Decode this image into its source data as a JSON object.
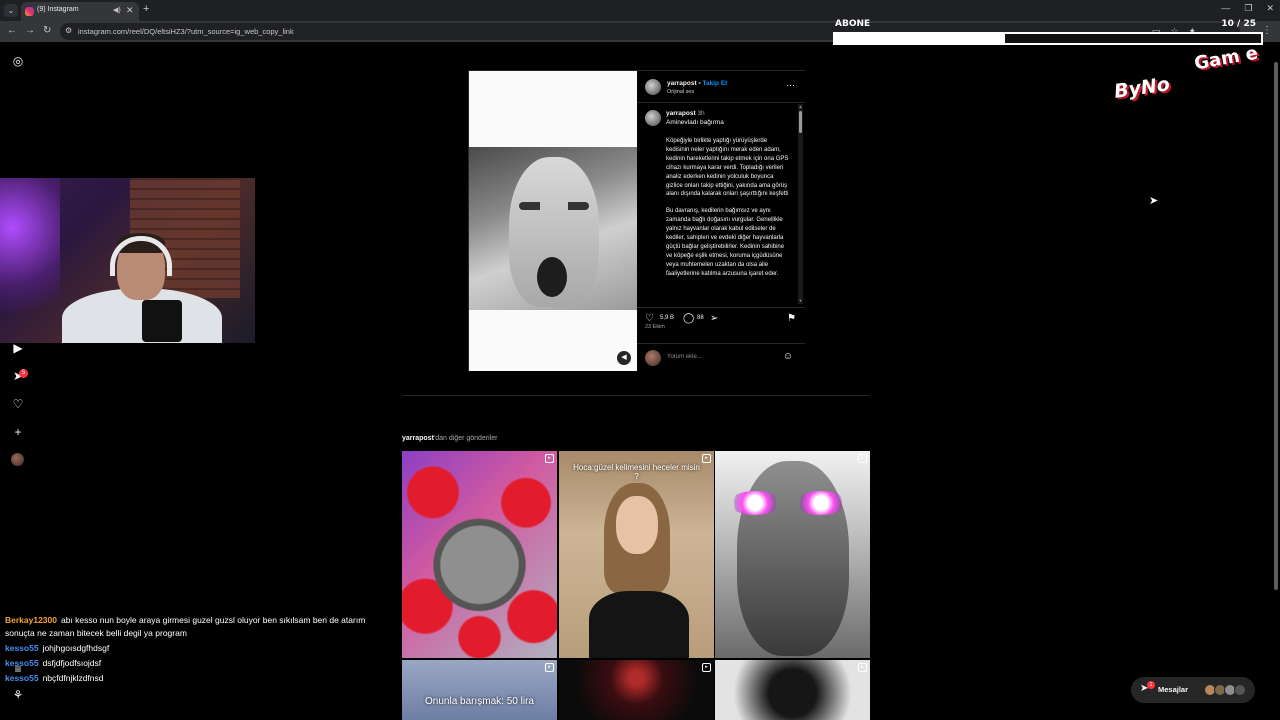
{
  "browser": {
    "tab_title": "(9) Instagram",
    "url": "instagram.com/reel/DQ/eltsiHZ3/?utm_source=ig_web_copy_link",
    "icons": [
      "tab-search-icon",
      "audio-icon",
      "close-icon",
      "new-tab-icon",
      "back-icon",
      "forward-icon",
      "reload-icon",
      "site-info-icon",
      "cast-icon",
      "star-icon",
      "extensions-icon",
      "menu-icon"
    ]
  },
  "stream_overlay": {
    "goal_label": "ABONE",
    "goal_count": "10 / 25",
    "goal_progress": 0.4,
    "logo_main": "ByNo",
    "logo_sub": "Gam e",
    "chat": [
      {
        "user": "Berkay12300",
        "color": "#f2a33a",
        "text": "abı kesso nun boyle araya girmesi guzel guzsl oluyor ben sıkılsam ben de atarım sonuçta ne zaman bitecek belli degil ya program"
      },
      {
        "user": "kesso55",
        "color": "#4a8ef0",
        "text": "johjhgoısdgfhdsgf"
      },
      {
        "user": "kesso55",
        "color": "#4a8ef0",
        "text": "dsfjdfjodfsıojdsf"
      },
      {
        "user": "kesso55",
        "color": "#4a8ef0",
        "text": "nbçfdfnjklzdfnsd"
      }
    ]
  },
  "sidebar": {
    "notifications_badge": "5",
    "icons": [
      "instagram-icon",
      "reels-icon",
      "direct-icon",
      "heart-icon",
      "create-icon",
      "profile-avatar",
      "menu-icon",
      "threads-icon"
    ]
  },
  "post": {
    "username": "yarrapost",
    "follow_label": "Takip Et",
    "separator": "•",
    "audio": "Orijinal ses",
    "caption_time": "3h",
    "caption_title": "Aminevladı bağırma",
    "caption_p1": "Köpeğiyle birlikte yaptığı yürüyüşlerde kedisinin neler yaptığını merak eden adam, kedinin hareketlerini takip etmek için ona GPS cihazı kurmaya karar verdi. Topladığı verileri analiz ederken kedinin yolculuk boyunca gizlice onları takip ettiğini, yakında ama görüş alanı dışında kalarak onları şaşırttığını keşfetti",
    "caption_p2": "Bu davranış, kedilerin bağımsız ve aynı zamanda bağlı doğasını vurgular. Genellikle yalnız hayvanlar olarak kabul edilseler de kediler, sahipleri ve evdeki diğer hayvanlarla güçlü bağlar geliştirebilirler. Kedinin sahibine ve köpeğe eşlik etmesi, koruma içgüdüsüne veya muhtemelen uzaktan da olsa aile faaliyetlerine katılma arzusuna işaret eder.",
    "likes": "5,9 B",
    "comments": "88",
    "date": "23 Ekim",
    "comment_placeholder": "Yorum ekle..."
  },
  "more_posts": {
    "username": "yarrapost",
    "suffix": "'dan diğer gönderiler",
    "tiles": [
      {
        "text": ""
      },
      {
        "text": "Hoca:güzel kelimesini heceler misin ?"
      },
      {
        "text": ""
      },
      {
        "text": "Onunla barışmak: 50 lira"
      },
      {
        "text": ""
      },
      {
        "text": ""
      }
    ]
  },
  "messages": {
    "label": "Mesajlar",
    "badge": "1"
  }
}
